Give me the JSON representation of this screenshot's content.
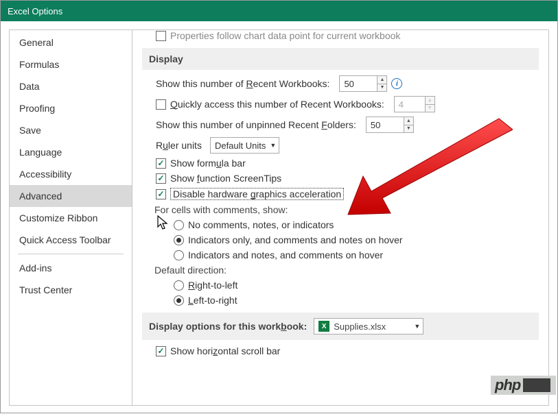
{
  "window": {
    "title": "Excel Options"
  },
  "sidebar": {
    "items": [
      "General",
      "Formulas",
      "Data",
      "Proofing",
      "Save",
      "Language",
      "Accessibility",
      "Advanced",
      "Customize Ribbon",
      "Quick Access Toolbar",
      "Add-ins",
      "Trust Center"
    ],
    "selected": "Advanced"
  },
  "main": {
    "truncated_top_label": "Properties follow chart data point for current workbook",
    "section_display": "Display",
    "recent_workbooks_label_pre": "Show this number of ",
    "recent_workbooks_label_u": "R",
    "recent_workbooks_label_post": "ecent Workbooks:",
    "recent_workbooks_value": "50",
    "quick_access_pre": "Q",
    "quick_access_post": "uickly access this number of Recent Workbooks:",
    "quick_access_value": "4",
    "recent_folders_label_pre": "Show this number of unpinned Recent ",
    "recent_folders_label_u": "F",
    "recent_folders_label_post": "olders:",
    "recent_folders_value": "50",
    "ruler_pre": "R",
    "ruler_mid": "u",
    "ruler_post": "ler units",
    "ruler_value": "Default Units",
    "show_formula_pre": "Show form",
    "show_formula_u": "u",
    "show_formula_post": "la bar",
    "show_screentips_pre": "Show ",
    "show_screentips_u": "f",
    "show_screentips_post": "unction ScreenTips",
    "disable_hw_pre": "Disable hardware ",
    "disable_hw_u": "g",
    "disable_hw_post": "raphics acceleration",
    "comments_heading": "For cells with comments, show:",
    "comment_opt1": "No comments, notes, or indicators",
    "comment_opt2": "Indicators only, and comments and notes on hover",
    "comment_opt3": "Indicators and notes, and comments on hover",
    "direction_heading": "Default direction:",
    "dir_rtl_u": "R",
    "dir_rtl_post": "ight-to-left",
    "dir_ltr_u": "L",
    "dir_ltr_post": "eft-to-right",
    "section_workbook_pre": "Display options for this work",
    "section_workbook_u": "b",
    "section_workbook_post": "ook:",
    "workbook_name": "Supplies.xlsx",
    "hscroll_pre": "Show hori",
    "hscroll_u": "z",
    "hscroll_post": "ontal scroll bar"
  },
  "watermark": "php"
}
